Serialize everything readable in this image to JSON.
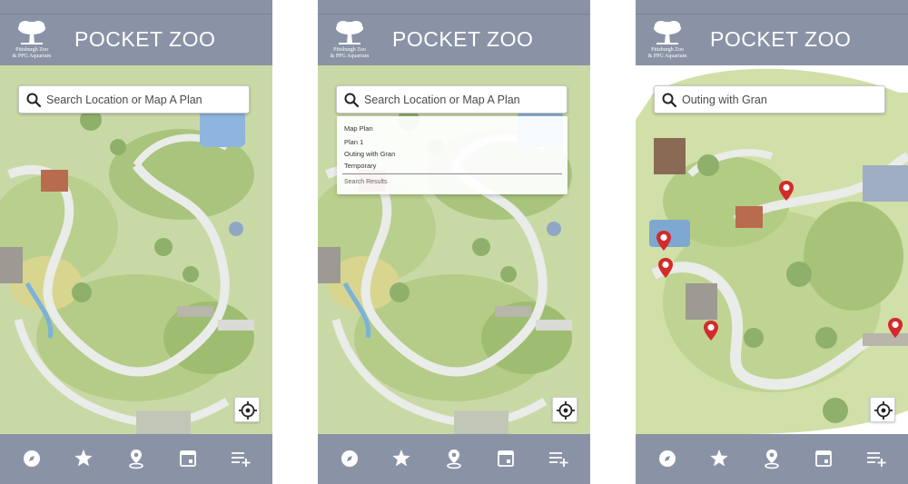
{
  "app": {
    "title": "POCKET ZOO",
    "logo_line1": "Pittsburgh Zoo",
    "logo_line2": "& PPG Aquarium"
  },
  "colors": {
    "header": "#8a93a6",
    "tabbar": "#8a93a6",
    "map_grass": "#c9d9a6",
    "pin": "#d42a2a"
  },
  "screens": [
    {
      "search": {
        "text": "Search Location or Map A Plan",
        "is_placeholder": true
      },
      "dropdown_open": false,
      "active_tab": "map"
    },
    {
      "search": {
        "text": "Search Location or Map A Plan",
        "is_placeholder": true
      },
      "dropdown_open": true,
      "dropdown": {
        "items": [
          "Map Plan",
          "Plan 1",
          "Outing with Gran",
          "Temporary"
        ],
        "footer": "Search Results"
      },
      "active_tab": "map"
    },
    {
      "search": {
        "text": "Outing with Gran",
        "is_placeholder": false
      },
      "dropdown_open": false,
      "pins_shown": 5,
      "active_tab": "map"
    }
  ],
  "tabs": [
    {
      "id": "explore",
      "icon": "compass-icon"
    },
    {
      "id": "favorites",
      "icon": "star-icon"
    },
    {
      "id": "map",
      "icon": "map-pin-icon"
    },
    {
      "id": "calendar",
      "icon": "calendar-icon"
    },
    {
      "id": "plans",
      "icon": "playlist-add-icon"
    }
  ]
}
